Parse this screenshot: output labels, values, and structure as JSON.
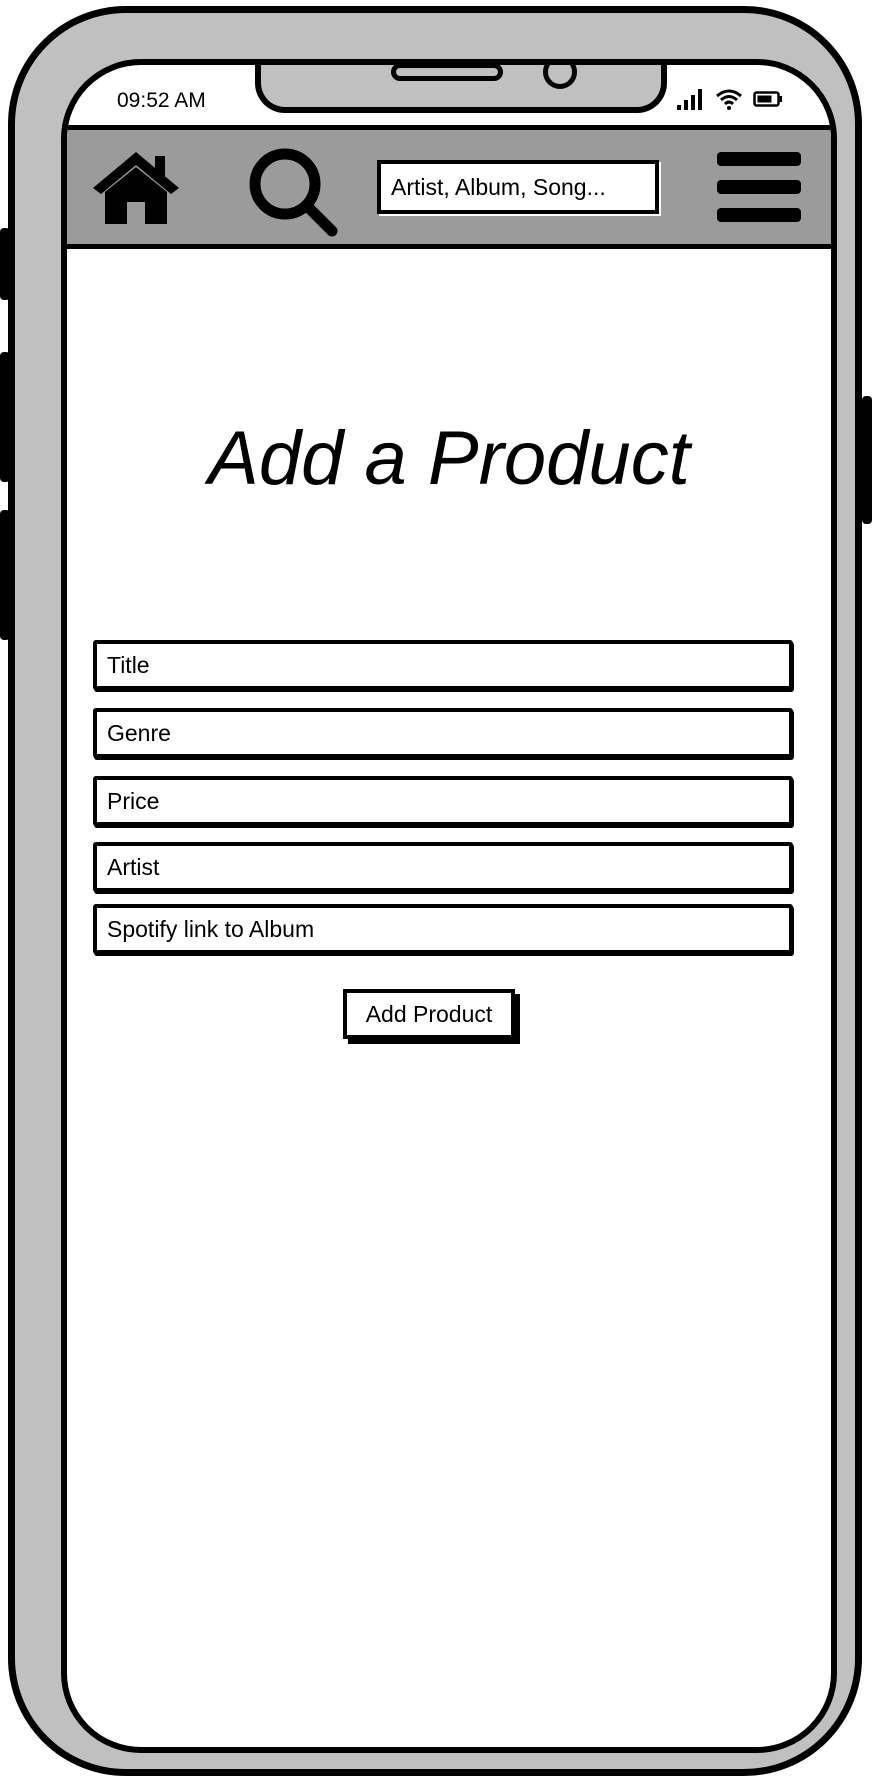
{
  "status_bar": {
    "time": "09:52 AM"
  },
  "header": {
    "icons": [
      "home-icon",
      "search-icon",
      "hamburger-menu-icon"
    ],
    "search": {
      "placeholder": "Artist, Album, Song..."
    }
  },
  "main": {
    "title": "Add a Product",
    "fields": [
      {
        "placeholder": "Title"
      },
      {
        "placeholder": "Genre"
      },
      {
        "placeholder": "Price"
      },
      {
        "placeholder": "Artist"
      },
      {
        "placeholder": "Spotify link to Album"
      }
    ],
    "submit_label": "Add Product"
  },
  "colors": {
    "frame": "#c0c0c0",
    "header": "#9b9b9b",
    "outline": "#000000",
    "screen": "#ffffff"
  }
}
